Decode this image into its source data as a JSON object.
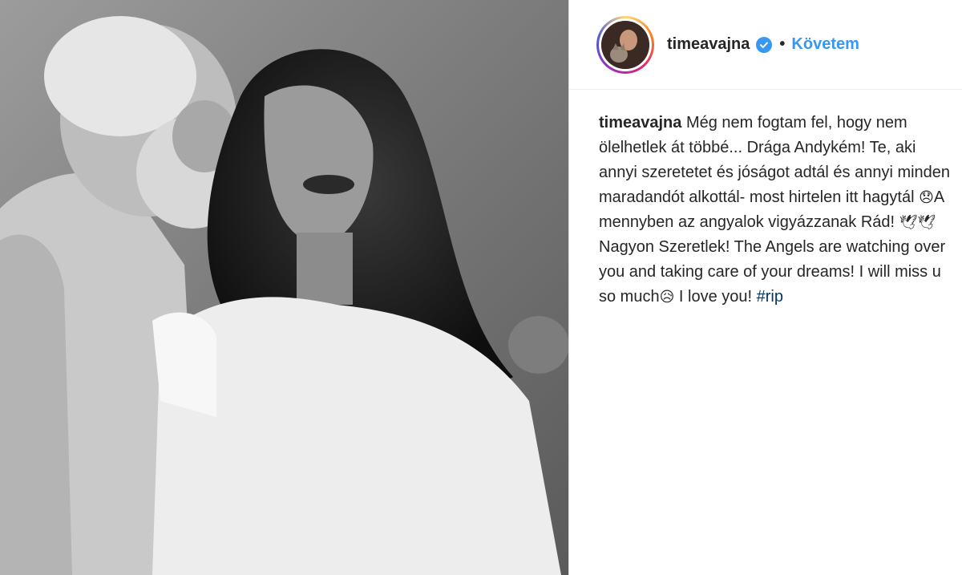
{
  "post": {
    "photo_alt": "",
    "author": {
      "username": "timeavajna",
      "verified": true,
      "follow_label": "Követem",
      "separator": "•"
    },
    "caption": {
      "username": "timeavajna",
      "text_1": "Még nem fogtam fel, hogy nem ölelhetlek át többé... Drága Andykém! Te, aki annyi szeretetet és jóságot adtál és annyi minden maradandót alkottál- most hirtelen itt hagytál",
      "emoji_1": "😞",
      "text_2": "A mennyben az angyalok vigyázzanak Rád!",
      "emoji_2": "🕊🕊",
      "text_3": "Nagyon Szeretlek! The Angels are watching over you and taking care of your dreams! I will miss u so much",
      "emoji_3": "😥",
      "text_4": " I love you! ",
      "hashtag": "#rip"
    },
    "colors": {
      "link_blue": "#3897f0",
      "hashtag_blue": "#003569",
      "text": "#262626"
    }
  }
}
